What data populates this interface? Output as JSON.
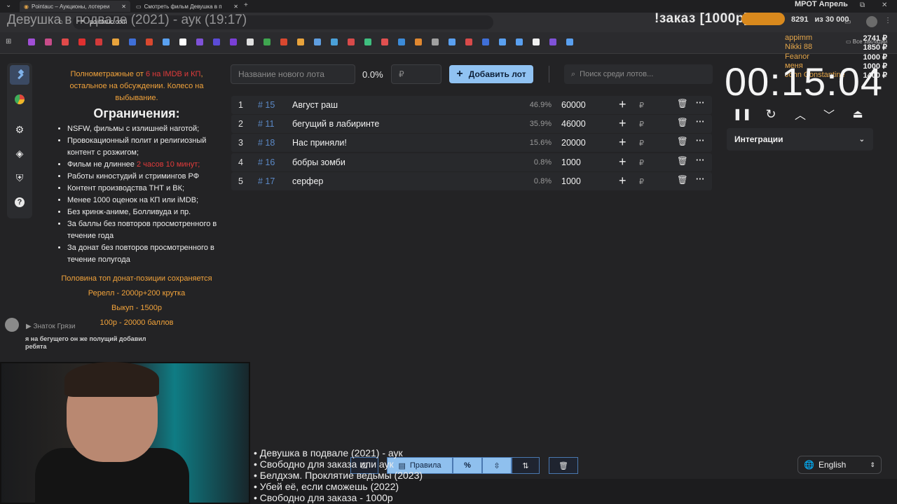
{
  "browser": {
    "tabs": [
      {
        "label": "Pointauc – Аукционы, лотереи"
      },
      {
        "label": "Смотреть фильм Девушка в п"
      }
    ],
    "url": "pointauc.com",
    "bookmarks_all": "Все закладки",
    "bookmark_labels": [
      "м",
      "b",
      "m",
      "Н"
    ]
  },
  "overlay": {
    "stream_title": "Девушка в подвале (2021) - аук (19:17)",
    "order_title": "!заказ [1000р]",
    "order_color": "#d9891d",
    "mrot_title": "МРОТ Апрель",
    "mrot_progress": "8291",
    "mrot_goal": "из 30 000",
    "donors": [
      {
        "name": "appimm",
        "amount": "2741 ₽"
      },
      {
        "name": "Nikki 88",
        "amount": "1850 ₽"
      },
      {
        "name": "Feanor",
        "amount": "1000 ₽"
      },
      {
        "name": "меня",
        "amount": "1000 ₽"
      },
      {
        "name": "John Constantine",
        "amount": "1400 ₽"
      }
    ]
  },
  "sidebar": {
    "icons": [
      "hammer-icon",
      "pie-chart-icon",
      "gear-icon",
      "layers-icon",
      "shield-icon",
      "help-icon"
    ]
  },
  "rules": {
    "intro_a": "Полнометражные от ",
    "intro_red": "6 на IMDB и КП",
    "intro_b": ", остальное на обсуждении. Колесо на выбывание.",
    "heading": "Ограничения:",
    "items": [
      "NSFW, фильмы с излишней наготой;",
      "Провокационный полит и религиозный контент с розжигом;",
      "Фильм не длиннее ",
      "Работы киностудий и стримингов РФ",
      "Контент производства ТНТ и ВК;",
      "Менее 1000 оценок на КП или iMDB;",
      "Без кринж-аниме, Болливуда и пр.",
      "За баллы без повторов просмотренного в течение года",
      "За донат без повторов просмотренного в течение полугода"
    ],
    "length_red": "2 часов 10 минут;",
    "footer": [
      "Половина топ донат-позиции сохраняется",
      "Ререлл - 2000р+200 крутка",
      "Выкуп - 1500р",
      "100р - 20000 баллов"
    ]
  },
  "chat": {
    "user": "Знаток Грязи",
    "message": "я на бегущего он же полущий добавил ребята"
  },
  "lot_form": {
    "name_placeholder": "Название нового лота",
    "percent": "0.0%",
    "amount_placeholder": "₽",
    "add_label": "Добавить лот",
    "search_placeholder": "Поиск среди лотов..."
  },
  "lots": [
    {
      "idx": "1",
      "id": "# 15",
      "name": "Август раш",
      "pct": "46.9%",
      "amount": "60000"
    },
    {
      "idx": "2",
      "id": "# 11",
      "name": "бегущий в лабиринте",
      "pct": "35.9%",
      "amount": "46000"
    },
    {
      "idx": "3",
      "id": "# 18",
      "name": "Нас приняли!",
      "pct": "15.6%",
      "amount": "20000"
    },
    {
      "idx": "4",
      "id": "# 16",
      "name": "бобры зомби",
      "pct": "0.8%",
      "amount": "1000"
    },
    {
      "idx": "5",
      "id": "# 17",
      "name": "серфер",
      "pct": "0.8%",
      "amount": "1000"
    }
  ],
  "lot_currency": "₽",
  "timer": {
    "value": "00:15:04",
    "integrations_label": "Интеграции"
  },
  "playlist": [
    "• Девушка в подвале (2021) - аук",
    "• Свободно для заказа или аук",
    "• Белдхэм. Проклятие ведьмы (2023)",
    "• Убей её, если сможешь (2022)",
    "• Свободно для заказа - 1000р"
  ],
  "toolbar": {
    "rules_label": "Правила",
    "percent_symbol": "%"
  },
  "language": "English",
  "accent": "#90c2f2"
}
